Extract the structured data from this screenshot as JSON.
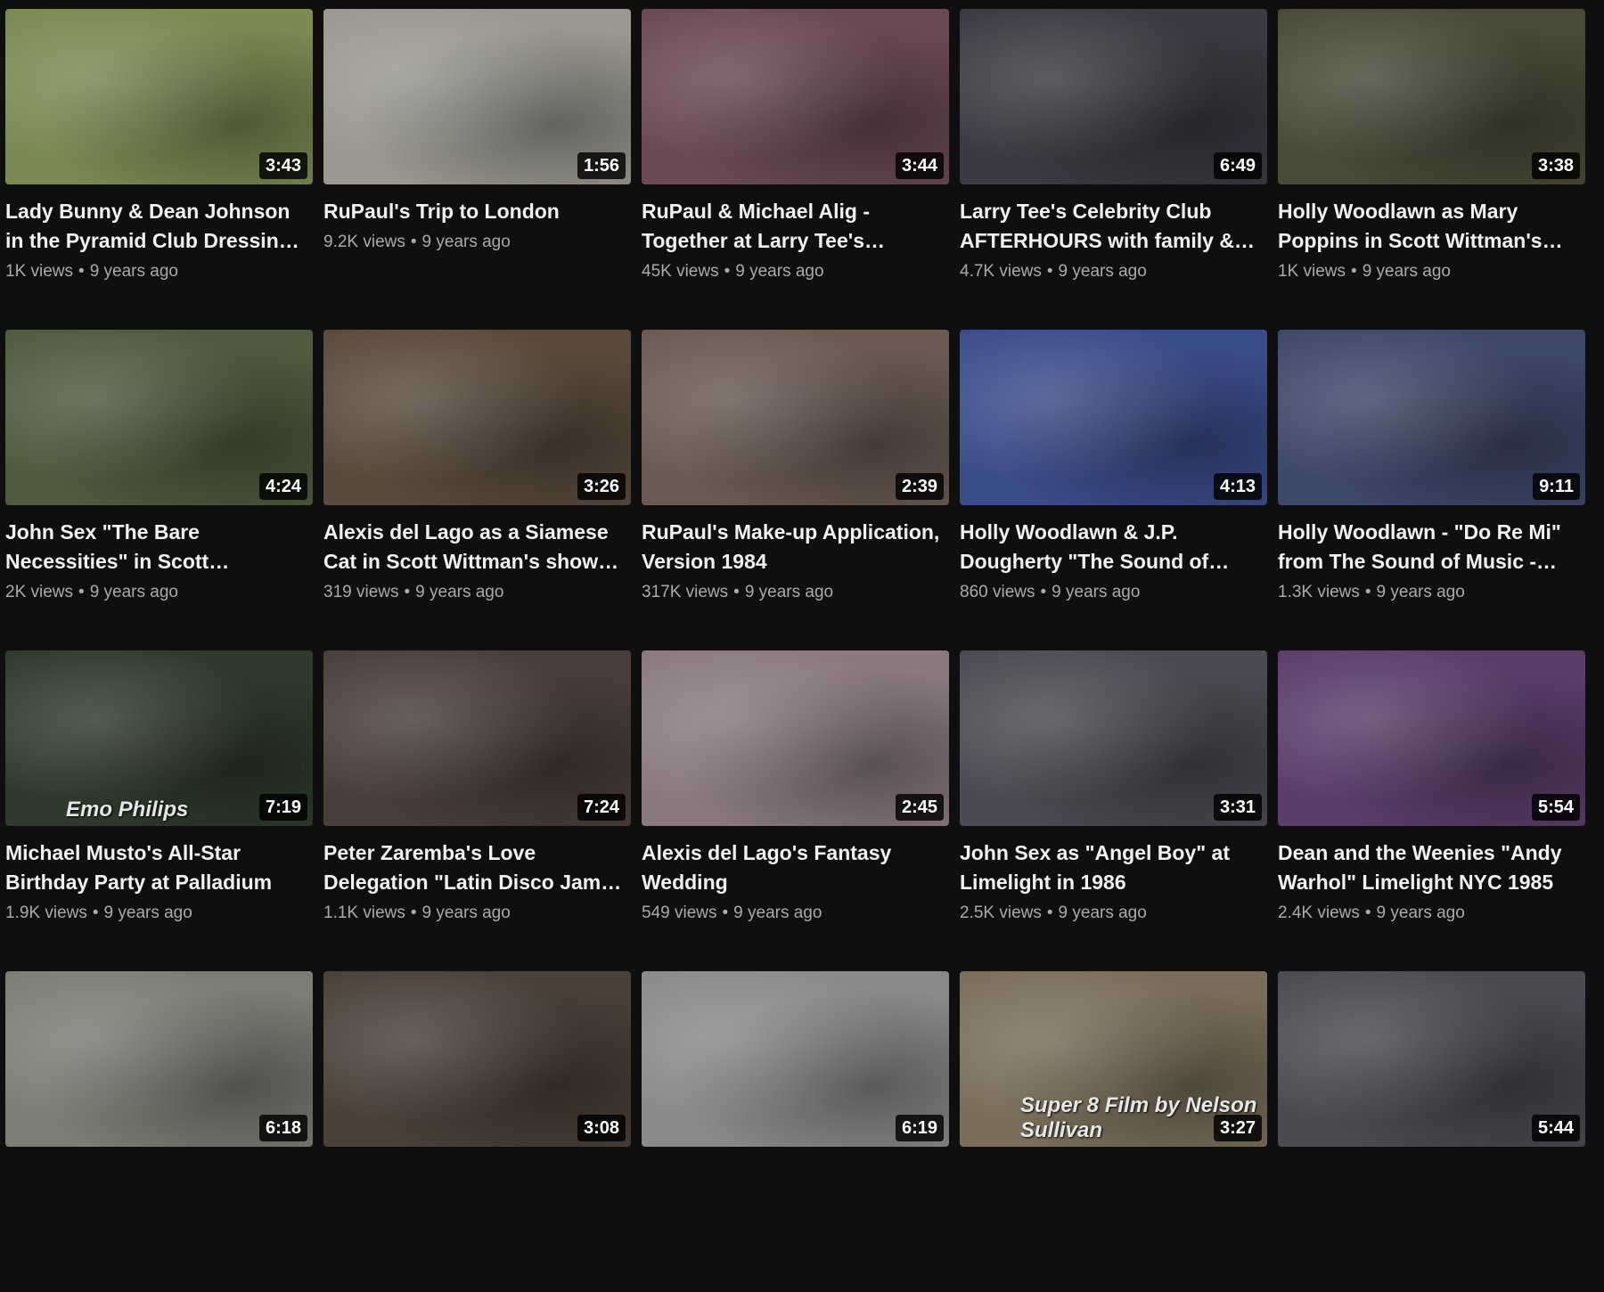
{
  "videos": [
    {
      "title": "Lady Bunny & Dean Johnson in the Pyramid Club Dressin…",
      "views": "1K views",
      "age": "9 years ago",
      "duration": "3:43",
      "thumb": "#7a8a52",
      "overlay": ""
    },
    {
      "title": "RuPaul's Trip to London",
      "views": "9.2K views",
      "age": "9 years ago",
      "duration": "1:56",
      "thumb": "#9a9890",
      "overlay": ""
    },
    {
      "title": "RuPaul & Michael Alig - Together at Larry Tee's…",
      "views": "45K views",
      "age": "9 years ago",
      "duration": "3:44",
      "thumb": "#6a4a52",
      "overlay": ""
    },
    {
      "title": "Larry Tee's Celebrity Club AFTERHOURS with family &…",
      "views": "4.7K views",
      "age": "9 years ago",
      "duration": "6:49",
      "thumb": "#3a3b42",
      "overlay": ""
    },
    {
      "title": "Holly Woodlawn as Mary Poppins in Scott Wittman's…",
      "views": "1K views",
      "age": "9 years ago",
      "duration": "3:38",
      "thumb": "#4a4a38",
      "overlay": ""
    },
    {
      "title": "John Sex \"The Bare Necessities\" in Scott…",
      "views": "2K views",
      "age": "9 years ago",
      "duration": "4:24",
      "thumb": "#4f5a3e",
      "overlay": ""
    },
    {
      "title": "Alexis del Lago as a Siamese Cat in Scott Wittman's show…",
      "views": "319 views",
      "age": "9 years ago",
      "duration": "3:26",
      "thumb": "#5a4a3c",
      "overlay": ""
    },
    {
      "title": "RuPaul's Make-up Application, Version 1984",
      "views": "317K views",
      "age": "9 years ago",
      "duration": "2:39",
      "thumb": "#6a5a52",
      "overlay": ""
    },
    {
      "title": "Holly Woodlawn & J.P. Dougherty \"The Sound of…",
      "views": "860 views",
      "age": "9 years ago",
      "duration": "4:13",
      "thumb": "#3b4c8a",
      "overlay": ""
    },
    {
      "title": "Holly Woodlawn - \"Do Re Mi\" from The Sound of Music -…",
      "views": "1.3K views",
      "age": "9 years ago",
      "duration": "9:11",
      "thumb": "#3e4868",
      "overlay": ""
    },
    {
      "title": "Michael Musto's All-Star Birthday Party at Palladium",
      "views": "1.9K views",
      "age": "9 years ago",
      "duration": "7:19",
      "thumb": "#2f3a2c",
      "overlay": "Emo Philips"
    },
    {
      "title": "Peter Zaremba's Love Delegation \"Latin Disco Jam…",
      "views": "1.1K views",
      "age": "9 years ago",
      "duration": "7:24",
      "thumb": "#4a3e3c",
      "overlay": ""
    },
    {
      "title": "Alexis del Lago's Fantasy Wedding",
      "views": "549 views",
      "age": "9 years ago",
      "duration": "2:45",
      "thumb": "#8a7a80",
      "overlay": ""
    },
    {
      "title": "John Sex as \"Angel Boy\" at Limelight in 1986",
      "views": "2.5K views",
      "age": "9 years ago",
      "duration": "3:31",
      "thumb": "#4a4a52",
      "overlay": ""
    },
    {
      "title": "Dean and the Weenies \"Andy Warhol\" Limelight NYC 1985",
      "views": "2.4K views",
      "age": "9 years ago",
      "duration": "5:54",
      "thumb": "#5a3e6a",
      "overlay": ""
    },
    {
      "title": "",
      "views": "",
      "age": "",
      "duration": "6:18",
      "thumb": "#7a7e74",
      "overlay": ""
    },
    {
      "title": "",
      "views": "",
      "age": "",
      "duration": "3:08",
      "thumb": "#4a4038",
      "overlay": ""
    },
    {
      "title": "",
      "views": "",
      "age": "",
      "duration": "6:19",
      "thumb": "#8a8a88",
      "overlay": ""
    },
    {
      "title": "",
      "views": "",
      "age": "",
      "duration": "3:27",
      "thumb": "#7a6e5a",
      "overlay": "Super 8 Film by Nelson Sullivan"
    },
    {
      "title": "",
      "views": "",
      "age": "",
      "duration": "5:44",
      "thumb": "#4a4a50",
      "overlay": ""
    }
  ]
}
